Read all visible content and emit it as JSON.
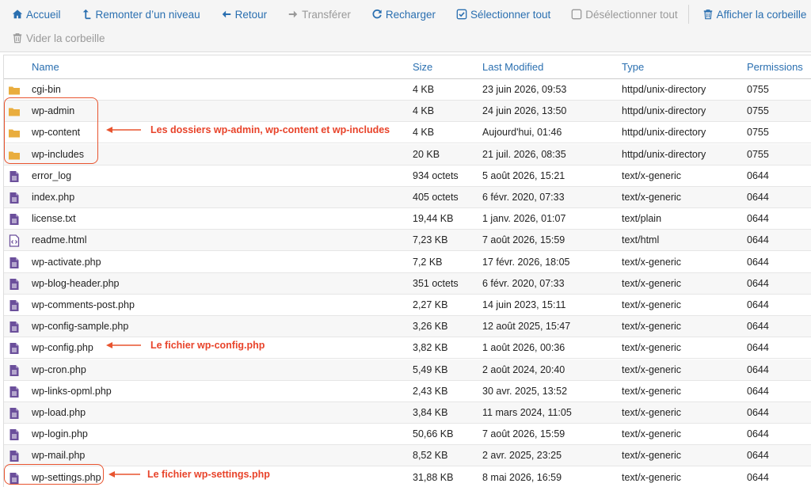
{
  "toolbar": {
    "row1": [
      {
        "id": "home",
        "label": "Accueil",
        "icon": "home-icon",
        "enabled": true
      },
      {
        "id": "up",
        "label": "Remonter d’un niveau",
        "icon": "level-up-icon",
        "enabled": true
      },
      {
        "id": "back",
        "label": "Retour",
        "icon": "arrow-left-icon",
        "enabled": true
      },
      {
        "id": "forward",
        "label": "Transférer",
        "icon": "arrow-right-icon",
        "enabled": false
      },
      {
        "id": "reload",
        "label": "Recharger",
        "icon": "reload-icon",
        "enabled": true
      },
      {
        "id": "select_all",
        "label": "Sélectionner tout",
        "icon": "checkbox-checked-icon",
        "enabled": true
      },
      {
        "id": "deselect_all",
        "label": "Désélectionner tout",
        "icon": "checkbox-empty-icon",
        "enabled": false
      },
      {
        "id": "show_trash",
        "label": "Afficher la corbeille",
        "icon": "trash-icon",
        "enabled": true
      }
    ],
    "row2": [
      {
        "id": "empty_trash",
        "label": "Vider la corbeille",
        "icon": "trash-icon",
        "enabled": false
      }
    ]
  },
  "table": {
    "columns": {
      "name": "Name",
      "size": "Size",
      "modified": "Last Modified",
      "type": "Type",
      "permissions": "Permissions"
    },
    "rows": [
      {
        "kind": "folder",
        "name": "cgi-bin",
        "size": "4 KB",
        "modified": "23 juin 2026, 09:53",
        "type": "httpd/unix-directory",
        "perm": "0755"
      },
      {
        "kind": "folder",
        "name": "wp-admin",
        "size": "4 KB",
        "modified": "24 juin 2026, 13:50",
        "type": "httpd/unix-directory",
        "perm": "0755"
      },
      {
        "kind": "folder",
        "name": "wp-content",
        "size": "4 KB",
        "modified": "Aujourd'hui, 01:46",
        "type": "httpd/unix-directory",
        "perm": "0755"
      },
      {
        "kind": "folder",
        "name": "wp-includes",
        "size": "20 KB",
        "modified": "21 juil. 2026, 08:35",
        "type": "httpd/unix-directory",
        "perm": "0755"
      },
      {
        "kind": "file",
        "name": "error_log",
        "size": "934 octets",
        "modified": "5 août 2026, 15:21",
        "type": "text/x-generic",
        "perm": "0644"
      },
      {
        "kind": "file",
        "name": "index.php",
        "size": "405 octets",
        "modified": "6 févr. 2020, 07:33",
        "type": "text/x-generic",
        "perm": "0644"
      },
      {
        "kind": "file",
        "name": "license.txt",
        "size": "19,44 KB",
        "modified": "1 janv. 2026, 01:07",
        "type": "text/plain",
        "perm": "0644"
      },
      {
        "kind": "html",
        "name": "readme.html",
        "size": "7,23 KB",
        "modified": "7 août 2026, 15:59",
        "type": "text/html",
        "perm": "0644"
      },
      {
        "kind": "file",
        "name": "wp-activate.php",
        "size": "7,2 KB",
        "modified": "17 févr. 2026, 18:05",
        "type": "text/x-generic",
        "perm": "0644"
      },
      {
        "kind": "file",
        "name": "wp-blog-header.php",
        "size": "351 octets",
        "modified": "6 févr. 2020, 07:33",
        "type": "text/x-generic",
        "perm": "0644"
      },
      {
        "kind": "file",
        "name": "wp-comments-post.php",
        "size": "2,27 KB",
        "modified": "14 juin 2023, 15:11",
        "type": "text/x-generic",
        "perm": "0644"
      },
      {
        "kind": "file",
        "name": "wp-config-sample.php",
        "size": "3,26 KB",
        "modified": "12 août 2025, 15:47",
        "type": "text/x-generic",
        "perm": "0644"
      },
      {
        "kind": "file",
        "name": "wp-config.php",
        "size": "3,82 KB",
        "modified": "1 août 2026, 00:36",
        "type": "text/x-generic",
        "perm": "0644"
      },
      {
        "kind": "file",
        "name": "wp-cron.php",
        "size": "5,49 KB",
        "modified": "2 août 2024, 20:40",
        "type": "text/x-generic",
        "perm": "0644"
      },
      {
        "kind": "file",
        "name": "wp-links-opml.php",
        "size": "2,43 KB",
        "modified": "30 avr. 2025, 13:52",
        "type": "text/x-generic",
        "perm": "0644"
      },
      {
        "kind": "file",
        "name": "wp-load.php",
        "size": "3,84 KB",
        "modified": "11 mars 2024, 11:05",
        "type": "text/x-generic",
        "perm": "0644"
      },
      {
        "kind": "file",
        "name": "wp-login.php",
        "size": "50,66 KB",
        "modified": "7 août 2026, 15:59",
        "type": "text/x-generic",
        "perm": "0644"
      },
      {
        "kind": "file",
        "name": "wp-mail.php",
        "size": "8,52 KB",
        "modified": "2 avr. 2025, 23:25",
        "type": "text/x-generic",
        "perm": "0644"
      },
      {
        "kind": "file",
        "name": "wp-settings.php",
        "size": "31,88 KB",
        "modified": "8 mai 2026, 16:59",
        "type": "text/x-generic",
        "perm": "0644"
      }
    ]
  },
  "annotations": {
    "folders_label": "Les dossiers wp-admin, wp-content et wp-includes",
    "config_label": "Le fichier wp-config.php",
    "settings_label": "Le fichier wp-settings.php"
  },
  "colors": {
    "link": "#2a6fb0",
    "folder": "#e9ad3e",
    "file": "#6b4f9b",
    "annotation": "#e8432a"
  }
}
